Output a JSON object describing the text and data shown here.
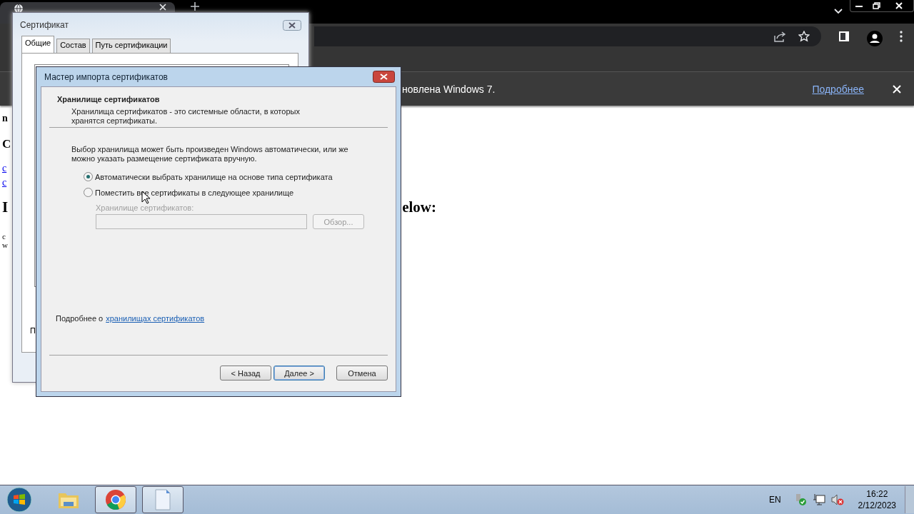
{
  "browser": {
    "infobar": {
      "message": "новлена Windows 7.",
      "link": "Подробнее"
    },
    "page": {
      "label": "n",
      "heading": "C",
      "links": [
        "c",
        "c"
      ],
      "heading2": {
        "start": "I",
        "end": "elow:"
      },
      "lines": [
        "c",
        "w"
      ]
    }
  },
  "certificate_window": {
    "title": "Сертификат",
    "tabs": [
      {
        "label": "Общие",
        "selected": true
      },
      {
        "label": "Состав",
        "selected": false
      },
      {
        "label": "Путь сертификации",
        "selected": false
      }
    ],
    "panel_text": "П"
  },
  "wizard": {
    "title": "Мастер импорта сертификатов",
    "header": "Хранилище сертификатов",
    "description": "Хранилища сертификатов - это системные области, в которых хранятся сертификаты.",
    "intro": "Выбор хранилища может быть произведен Windows автоматически, или же можно указать размещение сертификата вручную.",
    "options": [
      {
        "label": "Автоматически выбрать хранилище на основе типа сертификата",
        "selected": true
      },
      {
        "label": "Поместить все сертификаты в следующее хранилище",
        "selected": false
      }
    ],
    "store": {
      "label": "Хранилище сертификатов:",
      "browse": "Обзор...",
      "disabled": true
    },
    "more_prefix": "Подробнее о",
    "more_link": "хранилищах сертификатов",
    "buttons": [
      {
        "label": "< Назад",
        "default": false
      },
      {
        "label": "Далее >",
        "default": true
      },
      {
        "label": "Отмена",
        "default": false
      }
    ]
  },
  "taskbar": {
    "apps": [
      {
        "kind": "explorer",
        "running": false
      },
      {
        "kind": "chrome",
        "running": true
      },
      {
        "kind": "notepad",
        "running": true
      }
    ],
    "language": "EN",
    "time": "16:22",
    "date": "2/12/2023"
  }
}
